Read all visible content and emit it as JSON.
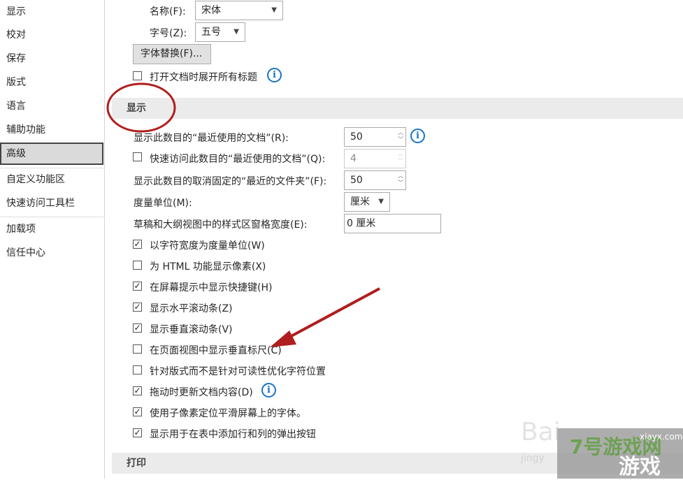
{
  "sidebar": {
    "items": [
      "显示",
      "校对",
      "保存",
      "版式",
      "语言",
      "辅助功能",
      "高级",
      "自定义功能区",
      "快速访问工具栏",
      "加载项",
      "信任中心"
    ],
    "selected": "高级"
  },
  "font": {
    "name_label": "名称(F):",
    "name_value": "宋体",
    "size_label": "字号(Z):",
    "size_value": "五号",
    "substitute_button": "字体替换(F)...",
    "expand_headings": {
      "label": "打开文档时展开所有标题",
      "checked": false
    }
  },
  "display_section": {
    "title": "显示",
    "recent_docs": {
      "label": "显示此数目的“最近使用的文档”(R):",
      "value": "50"
    },
    "quick_access": {
      "label": "快速访问此数目的“最近使用的文档”(Q):",
      "value": "4",
      "checked": false
    },
    "recent_folders": {
      "label": "显示此数目的取消固定的“最近的文件夹”(F):",
      "value": "50"
    },
    "units": {
      "label": "度量单位(M):",
      "value": "厘米"
    },
    "style_width": {
      "label": "草稿和大纲视图中的样式区窗格宽度(E):",
      "value": "0 厘米"
    },
    "options": [
      {
        "label": "以字符宽度为度量单位(W)",
        "checked": true
      },
      {
        "label": "为 HTML 功能显示像素(X)",
        "checked": false
      },
      {
        "label": "在屏幕提示中显示快捷键(H)",
        "checked": true
      },
      {
        "label": "显示水平滚动条(Z)",
        "checked": true
      },
      {
        "label": "显示垂直滚动条(V)",
        "checked": true
      },
      {
        "label": "在页面视图中显示垂直标尺(C)",
        "checked": false
      },
      {
        "label": "针对版式而不是针对可读性优化字符位置",
        "checked": false
      },
      {
        "label": "拖动时更新文档内容(D)",
        "checked": true
      },
      {
        "label": "使用子像素定位平滑屏幕上的字体。",
        "checked": true
      },
      {
        "label": "显示用于在表中添加行和列的弹出按钮",
        "checked": true
      }
    ]
  },
  "print_section": {
    "title": "打印"
  },
  "watermark": {
    "text": "Baidu jingyan 7号游戏网 xiayx.com ZHAOYOUXIWANG 游戏"
  },
  "annotation_color": "#b01e1e"
}
